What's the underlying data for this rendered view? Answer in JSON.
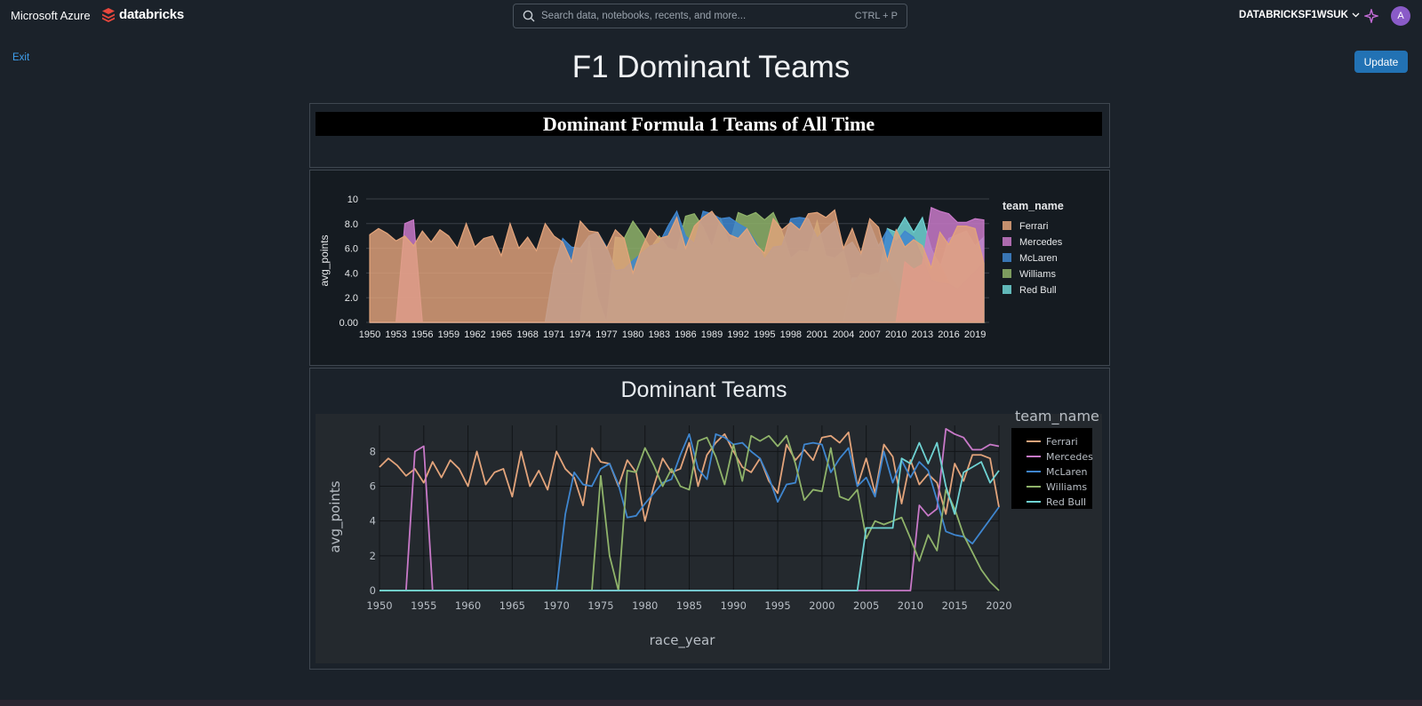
{
  "topbar": {
    "azure_label": "Microsoft Azure",
    "databricks_label": "databricks",
    "search_placeholder": "Search data, notebooks, recents, and more...",
    "search_shortcut": "CTRL + P",
    "workspace_name": "DATABRICKSF1WSUK",
    "avatar_initial": "A"
  },
  "page": {
    "exit_label": "Exit",
    "title": "F1 Dominant Teams",
    "update_label": "Update"
  },
  "html_widget": {
    "heading": "Dominant Formula 1 Teams of All Time"
  },
  "colors": {
    "Ferrari": "#e3a47b",
    "Mercedes": "#c879c8",
    "McLaren": "#3f86cf",
    "Williams": "#8fb36a",
    "Red Bull": "#6fd3d3"
  },
  "chart_data": [
    {
      "type": "area",
      "title": "",
      "xlabel": "",
      "ylabel": "avg_points",
      "legend_title": "team_name",
      "legend": [
        "Ferrari",
        "Mercedes",
        "McLaren",
        "Williams",
        "Red Bull"
      ],
      "legend_position": "right",
      "ylim": [
        0,
        10
      ],
      "y_ticks": [
        "0.00",
        "2.0",
        "4.0",
        "6.0",
        "8.0",
        "10"
      ],
      "x_ticks": [
        "1950",
        "1953",
        "1956",
        "1959",
        "1962",
        "1965",
        "1968",
        "1971",
        "1974",
        "1977",
        "1980",
        "1983",
        "1986",
        "1989",
        "1992",
        "1995",
        "1998",
        "2001",
        "2004",
        "2007",
        "2010",
        "2013",
        "2016",
        "2019"
      ],
      "x": [
        1950,
        1951,
        1952,
        1953,
        1954,
        1955,
        1956,
        1957,
        1958,
        1959,
        1960,
        1961,
        1962,
        1963,
        1964,
        1965,
        1966,
        1967,
        1968,
        1969,
        1970,
        1971,
        1972,
        1973,
        1974,
        1975,
        1976,
        1977,
        1978,
        1979,
        1980,
        1981,
        1982,
        1983,
        1984,
        1985,
        1986,
        1987,
        1988,
        1989,
        1990,
        1991,
        1992,
        1993,
        1994,
        1995,
        1996,
        1997,
        1998,
        1999,
        2000,
        2001,
        2002,
        2003,
        2004,
        2005,
        2006,
        2007,
        2008,
        2009,
        2010,
        2011,
        2012,
        2013,
        2014,
        2015,
        2016,
        2017,
        2018,
        2019,
        2020
      ],
      "series": [
        {
          "name": "Ferrari",
          "values": [
            7.1,
            7.6,
            7.2,
            6.6,
            7.0,
            6.2,
            7.4,
            6.5,
            7.5,
            7.0,
            6.0,
            8.0,
            6.1,
            6.8,
            7.0,
            5.4,
            8.0,
            6.0,
            6.9,
            5.8,
            8.0,
            7.0,
            6.5,
            4.9,
            8.2,
            7.4,
            7.3,
            6.0,
            7.5,
            6.8,
            4.0,
            6.0,
            7.6,
            6.8,
            7.0,
            8.5,
            6.0,
            7.8,
            8.5,
            9.0,
            8.0,
            7.1,
            6.8,
            7.6,
            6.3,
            5.6,
            8.4,
            7.5,
            8.1,
            7.5,
            8.8,
            8.9,
            8.5,
            9.1,
            6.0,
            7.6,
            5.6,
            8.4,
            7.7,
            5.0,
            7.5,
            6.1,
            6.7,
            6.2,
            4.4,
            7.3,
            6.3,
            7.8,
            7.8,
            7.6,
            4.8
          ]
        },
        {
          "name": "Mercedes",
          "values": [
            0,
            0,
            0,
            0,
            8.0,
            8.3,
            0,
            0,
            0,
            0,
            0,
            0,
            0,
            0,
            0,
            0,
            0,
            0,
            0,
            0,
            0,
            0,
            0,
            0,
            0,
            0,
            0,
            0,
            0,
            0,
            0,
            0,
            0,
            0,
            0,
            0,
            0,
            0,
            0,
            0,
            0,
            0,
            0,
            0,
            0,
            0,
            0,
            0,
            0,
            0,
            0,
            0,
            0,
            0,
            0,
            0,
            0,
            0,
            0,
            0,
            0,
            4.9,
            4.3,
            4.7,
            9.3,
            9.0,
            8.8,
            8.1,
            8.1,
            8.4,
            8.3
          ]
        },
        {
          "name": "McLaren",
          "values": [
            0,
            0,
            0,
            0,
            0,
            0,
            0,
            0,
            0,
            0,
            0,
            0,
            0,
            0,
            0,
            0,
            0,
            0,
            0,
            0,
            0,
            4.4,
            6.8,
            6.1,
            6.0,
            7.0,
            7.3,
            6.1,
            4.2,
            4.3,
            5.0,
            5.6,
            6.2,
            6.4,
            7.8,
            9.0,
            7.0,
            6.4,
            9.0,
            8.8,
            8.4,
            8.5,
            8.0,
            7.6,
            6.5,
            5.1,
            6.1,
            6.2,
            8.4,
            8.5,
            8.4,
            6.8,
            7.6,
            8.2,
            6.0,
            6.5,
            5.4,
            8.0,
            6.2,
            7.5,
            6.5,
            7.4,
            6.9,
            5.2,
            3.4,
            3.2,
            3.1,
            2.7,
            3.4,
            4.1,
            4.8
          ]
        },
        {
          "name": "Williams",
          "values": [
            0,
            0,
            0,
            0,
            0,
            0,
            0,
            0,
            0,
            0,
            0,
            0,
            0,
            0,
            0,
            0,
            0,
            0,
            0,
            0,
            0,
            0,
            0,
            0,
            0,
            6.6,
            2.0,
            0,
            6.9,
            6.8,
            8.2,
            7.2,
            6.0,
            7.0,
            6.0,
            5.8,
            8.6,
            8.8,
            7.7,
            6.1,
            8.4,
            6.3,
            8.9,
            8.6,
            8.9,
            8.3,
            8.9,
            7.3,
            5.2,
            5.8,
            5.7,
            8.2,
            5.4,
            5.2,
            5.8,
            3.0,
            4.0,
            3.8,
            4.0,
            4.2,
            3.0,
            1.7,
            3.2,
            2.3,
            5.8,
            4.7,
            3.2,
            2.2,
            1.2,
            0.5,
            0
          ]
        },
        {
          "name": "Red Bull",
          "values": [
            0,
            0,
            0,
            0,
            0,
            0,
            0,
            0,
            0,
            0,
            0,
            0,
            0,
            0,
            0,
            0,
            0,
            0,
            0,
            0,
            0,
            0,
            0,
            0,
            0,
            0,
            0,
            0,
            0,
            0,
            0,
            0,
            0,
            0,
            0,
            0,
            0,
            0,
            0,
            0,
            0,
            0,
            0,
            0,
            0,
            0,
            0,
            0,
            0,
            0,
            0,
            0,
            0,
            0,
            0,
            3.6,
            3.6,
            3.6,
            3.6,
            7.6,
            7.3,
            8.5,
            7.3,
            8.5,
            6.0,
            4.4,
            6.8,
            7.1,
            7.4,
            6.2,
            6.9
          ]
        }
      ]
    },
    {
      "type": "line",
      "title": "Dominant Teams",
      "xlabel": "race_year",
      "ylabel": "avg_points",
      "legend_title": "team_name",
      "legend": [
        "Ferrari",
        "Mercedes",
        "McLaren",
        "Williams",
        "Red Bull"
      ],
      "legend_position": "top-right",
      "xlim": [
        1950,
        2020
      ],
      "ylim": [
        0,
        9.5
      ],
      "x_ticks": [
        "1950",
        "1955",
        "1960",
        "1965",
        "1970",
        "1975",
        "1980",
        "1985",
        "1990",
        "1995",
        "2000",
        "2005",
        "2010",
        "2015",
        "2020"
      ],
      "y_ticks": [
        "0",
        "2",
        "4",
        "6",
        "8"
      ],
      "grid": true
    }
  ]
}
